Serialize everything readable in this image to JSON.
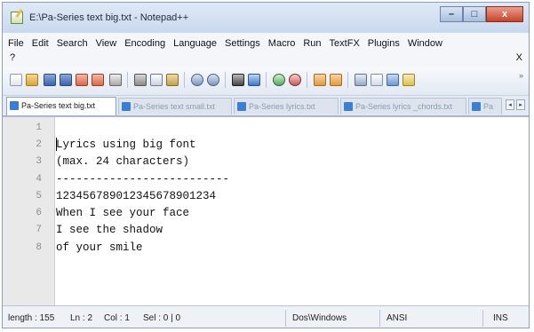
{
  "window": {
    "title": "E:\\Pa-Series text big.txt - Notepad++"
  },
  "window_buttons": {
    "minimize": "–",
    "maximize": "□",
    "close": "x"
  },
  "menu": {
    "items": [
      "File",
      "Edit",
      "Search",
      "View",
      "Encoding",
      "Language",
      "Settings",
      "Macro",
      "Run",
      "TextFX",
      "Plugins",
      "Window"
    ],
    "help": "?",
    "close_doc": "X"
  },
  "toolbar": {
    "icons": [
      "new-file-icon",
      "open-file-icon",
      "save-icon",
      "save-all-icon",
      "close-icon",
      "close-all-icon",
      "print-icon",
      "cut-icon",
      "copy-icon",
      "paste-icon",
      "undo-icon",
      "redo-icon",
      "find-icon",
      "replace-icon",
      "zoom-in-icon",
      "zoom-out-icon",
      "sync-vertical-icon",
      "sync-horizontal-icon",
      "word-wrap-icon",
      "show-all-chars-icon",
      "indent-guide-icon",
      "user-language-icon"
    ],
    "overflow": "»"
  },
  "tabs": [
    {
      "label": "Pa-Series text big.txt",
      "active": true
    },
    {
      "label": "Pa-Series text small.txt",
      "active": false
    },
    {
      "label": "Pa-Series lyrics.txt",
      "active": false
    },
    {
      "label": "Pa-Series lyrics _chords.txt",
      "active": false
    },
    {
      "label": "Pa",
      "active": false
    }
  ],
  "tab_scroll": {
    "left": "◂",
    "right": "▸"
  },
  "editor": {
    "line_numbers": [
      "1",
      "2",
      "3",
      "4",
      "5",
      "6",
      "7",
      "8"
    ],
    "lines": [
      "",
      "Lyrics using big font",
      "(max. 24 characters)",
      "--------------------------",
      "123456789012345678901234",
      "When I see your face",
      "I see the shadow",
      "of your smile"
    ]
  },
  "status": {
    "length_label": "length : 155",
    "ln": "Ln : 2",
    "col": "Col : 1",
    "sel": "Sel : 0 | 0",
    "eol": "Dos\\Windows",
    "encoding": "ANSI",
    "mode": "INS"
  },
  "colors": {
    "accent": "#3a7fd5",
    "close_button": "#c7432a"
  }
}
